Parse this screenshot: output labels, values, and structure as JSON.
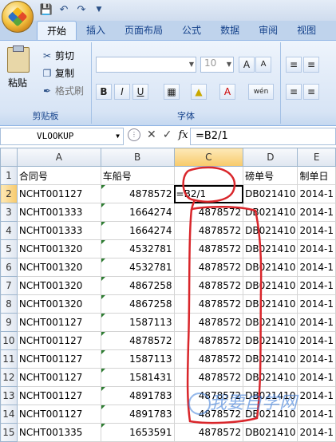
{
  "qat": {
    "save_icon": "save-icon",
    "undo_icon": "undo-icon",
    "redo_icon": "redo-icon",
    "dropdown_icon": "chevron-down-icon"
  },
  "tabs": [
    "开始",
    "插入",
    "页面布局",
    "公式",
    "数据",
    "审阅",
    "视图"
  ],
  "clipboard": {
    "paste": "粘贴",
    "cut": "剪切",
    "copy": "复制",
    "format_painter": "格式刷",
    "group_label": "剪贴板"
  },
  "font": {
    "name": "",
    "size": "10",
    "group_label": "字体",
    "bold": "B",
    "italic": "I",
    "underline": "U",
    "grow": "A",
    "shrink": "A",
    "color": "A"
  },
  "formula_bar": {
    "name_box": "VLOOKUP",
    "fx": "fx",
    "formula": "=B2/1"
  },
  "columns": [
    "A",
    "B",
    "C",
    "D",
    "E"
  ],
  "rows": [
    {
      "n": "1",
      "a": "合同号",
      "b": "车船号",
      "c": "",
      "d": "磅单号",
      "e": "制单日"
    },
    {
      "n": "2",
      "a": "NCHT001127",
      "b": "4878572",
      "c": "=B2/1",
      "d": "DB021410",
      "e": "2014-1"
    },
    {
      "n": "3",
      "a": "NCHT001333",
      "b": "1664274",
      "c": "4878572",
      "d": "DB021410",
      "e": "2014-1"
    },
    {
      "n": "4",
      "a": "NCHT001333",
      "b": "1664274",
      "c": "4878572",
      "d": "DB021410",
      "e": "2014-1"
    },
    {
      "n": "5",
      "a": "NCHT001320",
      "b": "4532781",
      "c": "4878572",
      "d": "DB021410",
      "e": "2014-1"
    },
    {
      "n": "6",
      "a": "NCHT001320",
      "b": "4532781",
      "c": "4878572",
      "d": "DB021410",
      "e": "2014-1"
    },
    {
      "n": "7",
      "a": "NCHT001320",
      "b": "4867258",
      "c": "4878572",
      "d": "DB021410",
      "e": "2014-1"
    },
    {
      "n": "8",
      "a": "NCHT001320",
      "b": "4867258",
      "c": "4878572",
      "d": "DB021410",
      "e": "2014-1"
    },
    {
      "n": "9",
      "a": "NCHT001127",
      "b": "1587113",
      "c": "4878572",
      "d": "DB021410",
      "e": "2014-1"
    },
    {
      "n": "10",
      "a": "NCHT001127",
      "b": "4878572",
      "c": "4878572",
      "d": "DB021410",
      "e": "2014-1"
    },
    {
      "n": "11",
      "a": "NCHT001127",
      "b": "1587113",
      "c": "4878572",
      "d": "DB021410",
      "e": "2014-1"
    },
    {
      "n": "12",
      "a": "NCHT001127",
      "b": "1581431",
      "c": "4878572",
      "d": "DB021410",
      "e": "2014-1"
    },
    {
      "n": "13",
      "a": "NCHT001127",
      "b": "4891783",
      "c": "4878572",
      "d": "DB021410",
      "e": "2014-1"
    },
    {
      "n": "14",
      "a": "NCHT001127",
      "b": "4891783",
      "c": "4878572",
      "d": "DB021410",
      "e": "2014-1"
    },
    {
      "n": "15",
      "a": "NCHT001335",
      "b": "1653591",
      "c": "4878572",
      "d": "DB021410",
      "e": "2014-1"
    }
  ],
  "annotation_color": "#d9262b",
  "watermark": "我要自学网"
}
